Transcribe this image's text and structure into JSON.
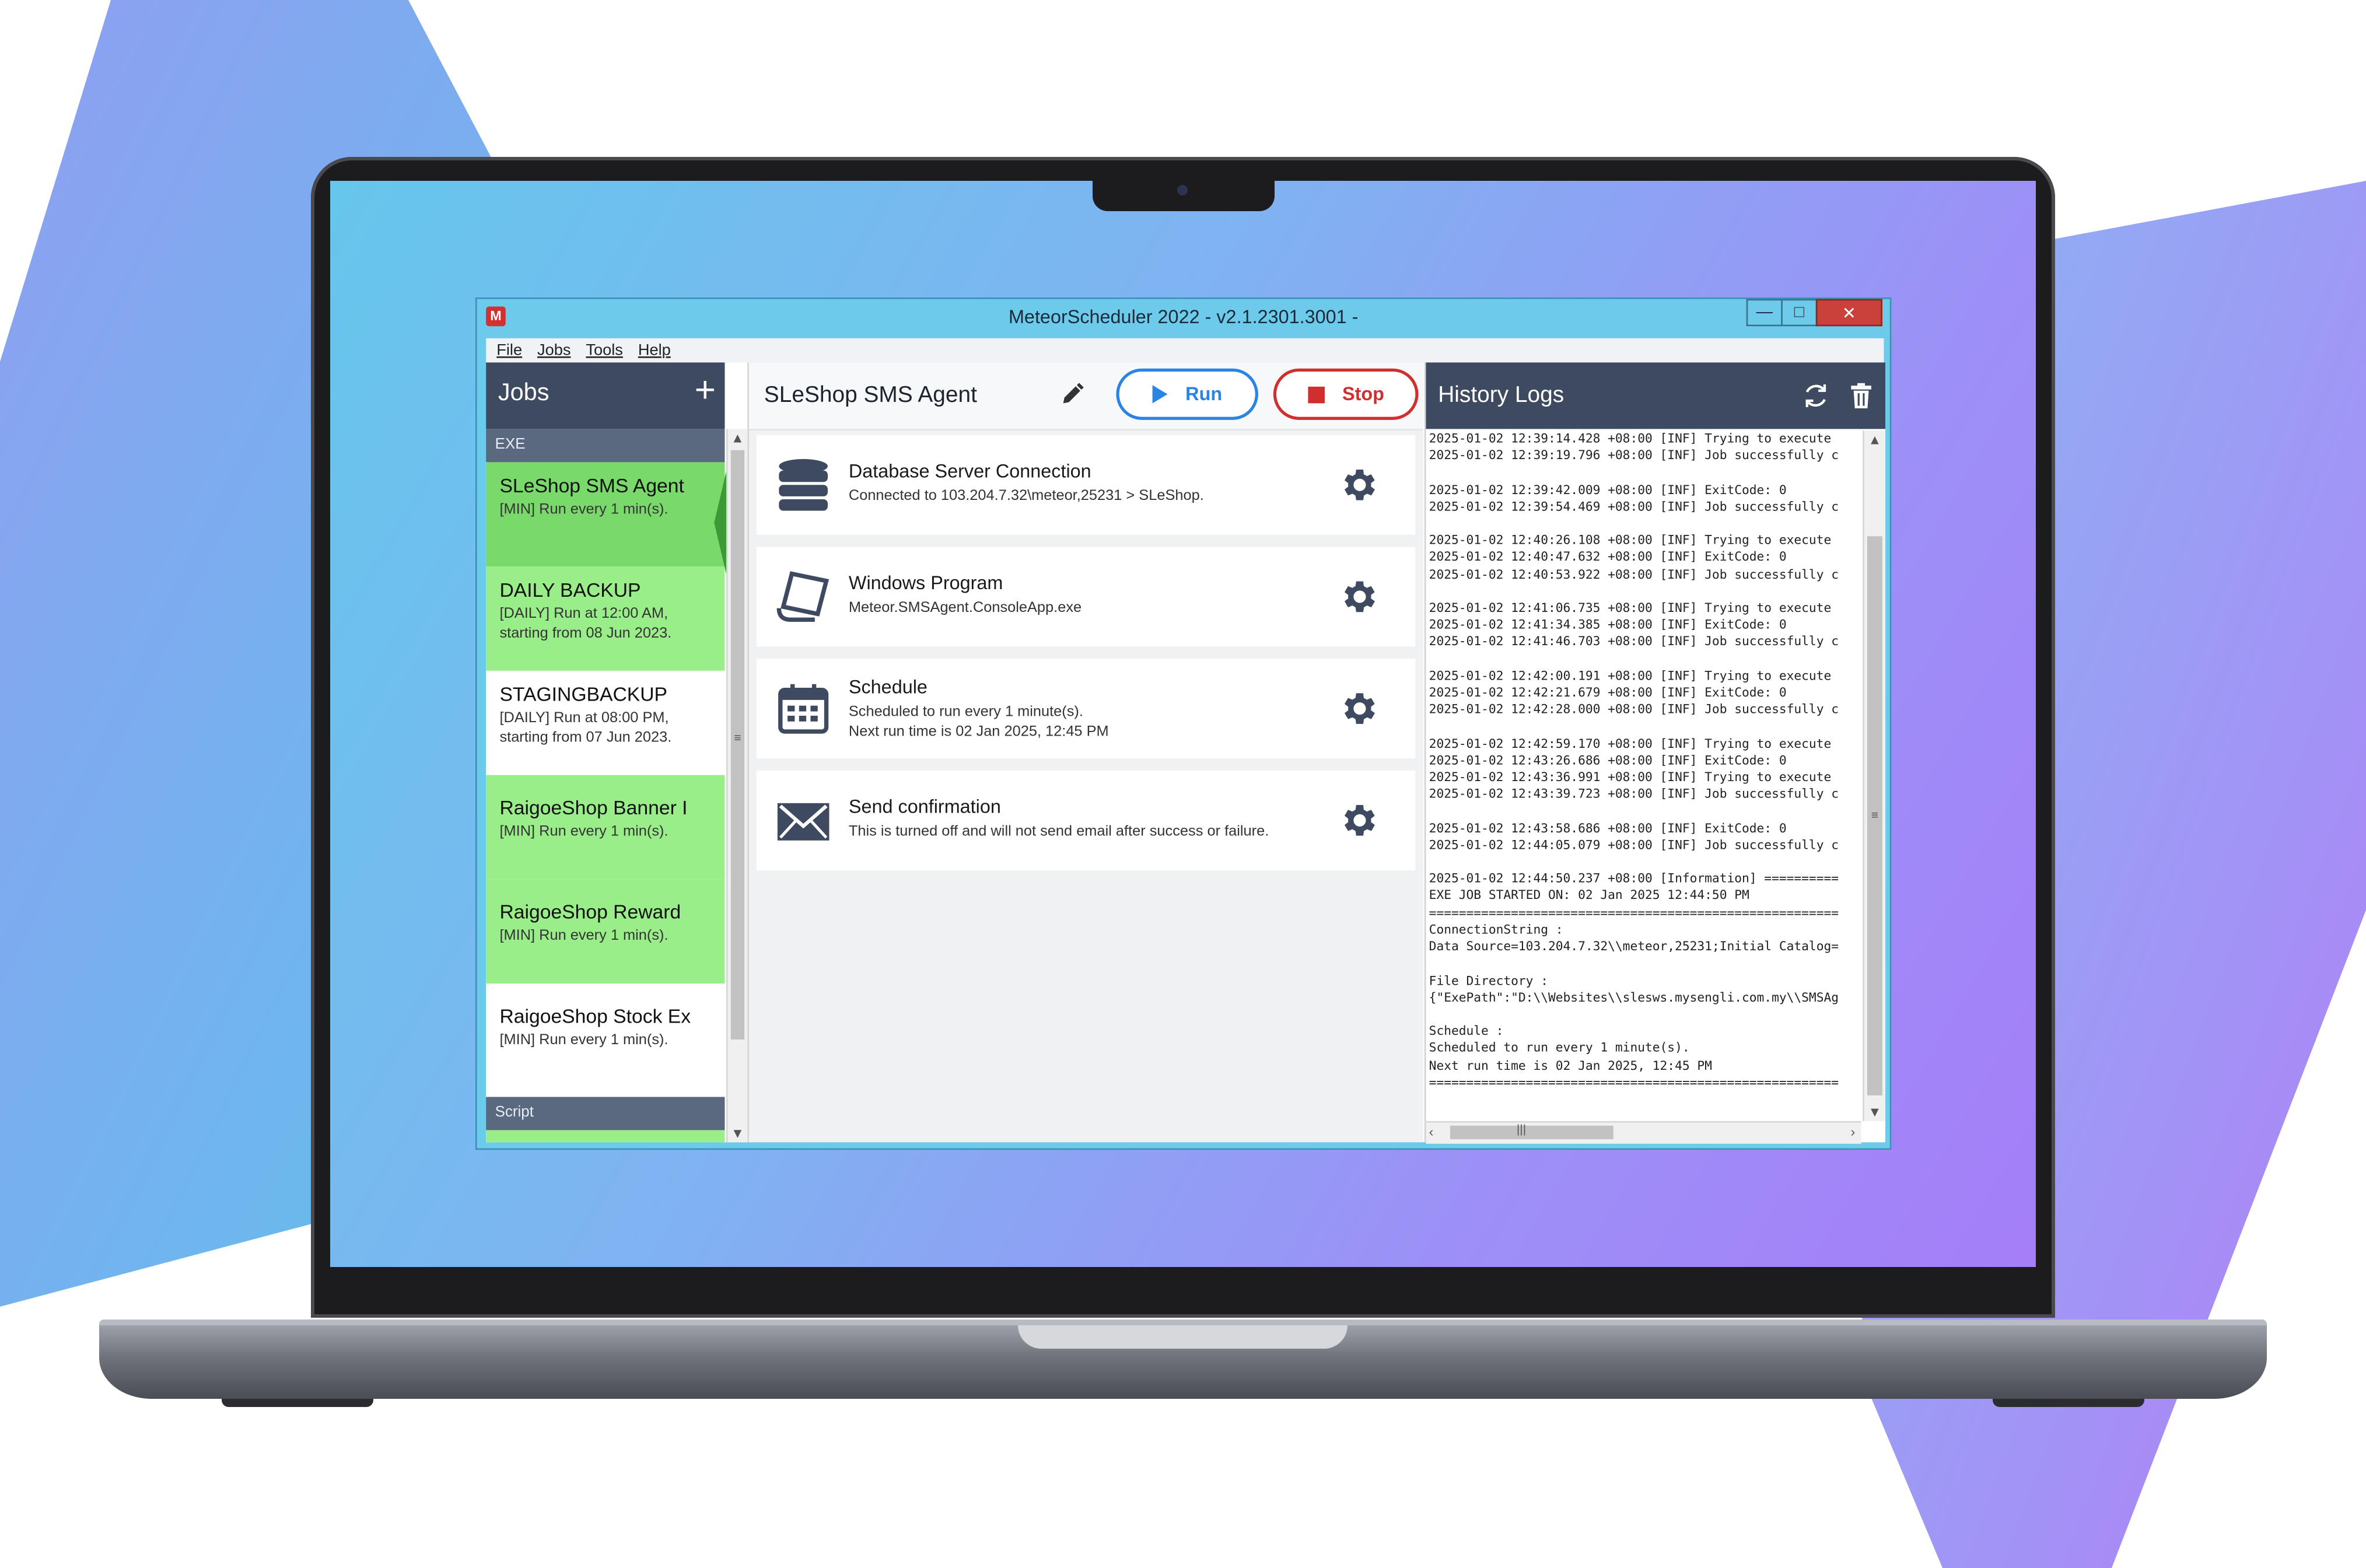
{
  "window": {
    "title": "MeteorScheduler 2022 - v2.1.2301.3001 -",
    "logo": "M",
    "controls": {
      "minimize": "—",
      "maximize": "□",
      "close": "✕"
    }
  },
  "menu": [
    "File",
    "Jobs",
    "Tools",
    "Help"
  ],
  "jobs": {
    "title": "Jobs",
    "add_label": "+",
    "groups": {
      "exe": "EXE",
      "script": "Script"
    },
    "items": [
      {
        "name": "SLeShop SMS Agent",
        "desc": "[MIN] Run every 1 min(s)."
      },
      {
        "name": "DAILY BACKUP",
        "desc1": "[DAILY] Run at 12:00 AM,",
        "desc2": "starting from 08 Jun 2023."
      },
      {
        "name": "STAGINGBACKUP",
        "desc1": "[DAILY] Run at 08:00 PM,",
        "desc2": "starting from 07 Jun 2023."
      },
      {
        "name": "RaigoeShop Banner I",
        "desc": "[MIN] Run every 1 min(s)."
      },
      {
        "name": "RaigoeShop Reward",
        "desc": "[MIN] Run every 1 min(s)."
      },
      {
        "name": "RaigoeShop Stock Ex",
        "desc": "[MIN] Run every 1 min(s)."
      }
    ]
  },
  "detail": {
    "title": "SLeShop SMS Agent",
    "run_label": "Run",
    "stop_label": "Stop",
    "cards": [
      {
        "title": "Database Server Connection",
        "desc": "Connected to 103.204.7.32\\meteor,25231 > SLeShop.",
        "icon": "database-icon"
      },
      {
        "title": "Windows Program",
        "desc": "Meteor.SMSAgent.ConsoleApp.exe",
        "icon": "program-icon"
      },
      {
        "title": "Schedule",
        "desc1": "Scheduled to run every 1 minute(s).",
        "desc2": "Next run time is 02 Jan 2025, 12:45 PM",
        "icon": "calendar-icon"
      },
      {
        "title": "Send confirmation",
        "desc": "This is turned off and will not send email after success or failure.",
        "icon": "envelope-icon"
      }
    ]
  },
  "history": {
    "title": "History Logs",
    "lines": [
      "2025-01-02 12:39:14.428 +08:00 [INF] Trying to execute",
      "2025-01-02 12:39:19.796 +08:00 [INF] Job successfully c",
      "",
      "2025-01-02 12:39:42.009 +08:00 [INF] ExitCode: 0",
      "2025-01-02 12:39:54.469 +08:00 [INF] Job successfully c",
      "",
      "2025-01-02 12:40:26.108 +08:00 [INF] Trying to execute",
      "2025-01-02 12:40:47.632 +08:00 [INF] ExitCode: 0",
      "2025-01-02 12:40:53.922 +08:00 [INF] Job successfully c",
      "",
      "2025-01-02 12:41:06.735 +08:00 [INF] Trying to execute",
      "2025-01-02 12:41:34.385 +08:00 [INF] ExitCode: 0",
      "2025-01-02 12:41:46.703 +08:00 [INF] Job successfully c",
      "",
      "2025-01-02 12:42:00.191 +08:00 [INF] Trying to execute",
      "2025-01-02 12:42:21.679 +08:00 [INF] ExitCode: 0",
      "2025-01-02 12:42:28.000 +08:00 [INF] Job successfully c",
      "",
      "2025-01-02 12:42:59.170 +08:00 [INF] Trying to execute",
      "2025-01-02 12:43:26.686 +08:00 [INF] ExitCode: 0",
      "2025-01-02 12:43:36.991 +08:00 [INF] Trying to execute",
      "2025-01-02 12:43:39.723 +08:00 [INF] Job successfully c",
      "",
      "2025-01-02 12:43:58.686 +08:00 [INF] ExitCode: 0",
      "2025-01-02 12:44:05.079 +08:00 [INF] Job successfully c",
      "",
      "2025-01-02 12:44:50.237 +08:00 [Information] ==========",
      "EXE JOB STARTED ON: 02 Jan 2025 12:44:50 PM",
      "=======================================================",
      "ConnectionString :",
      "Data Source=103.204.7.32\\\\meteor,25231;Initial Catalog=",
      "",
      "File Directory :",
      "{\"ExePath\":\"D:\\\\Websites\\\\slesws.mysengli.com.my\\\\SMSAg",
      "",
      "Schedule :",
      "Scheduled to run every 1 minute(s).",
      "Next run time is 02 Jan 2025, 12:45 PM",
      "======================================================="
    ]
  },
  "colors": {
    "screen_gradient": [
      "#66c6ec",
      "#a57ef8"
    ],
    "panel_header": "#3e4a5f",
    "job_active": "#7ad96b",
    "job_enabled": "#9aee8a",
    "run": "#2a84e6",
    "stop": "#d12e2e"
  }
}
